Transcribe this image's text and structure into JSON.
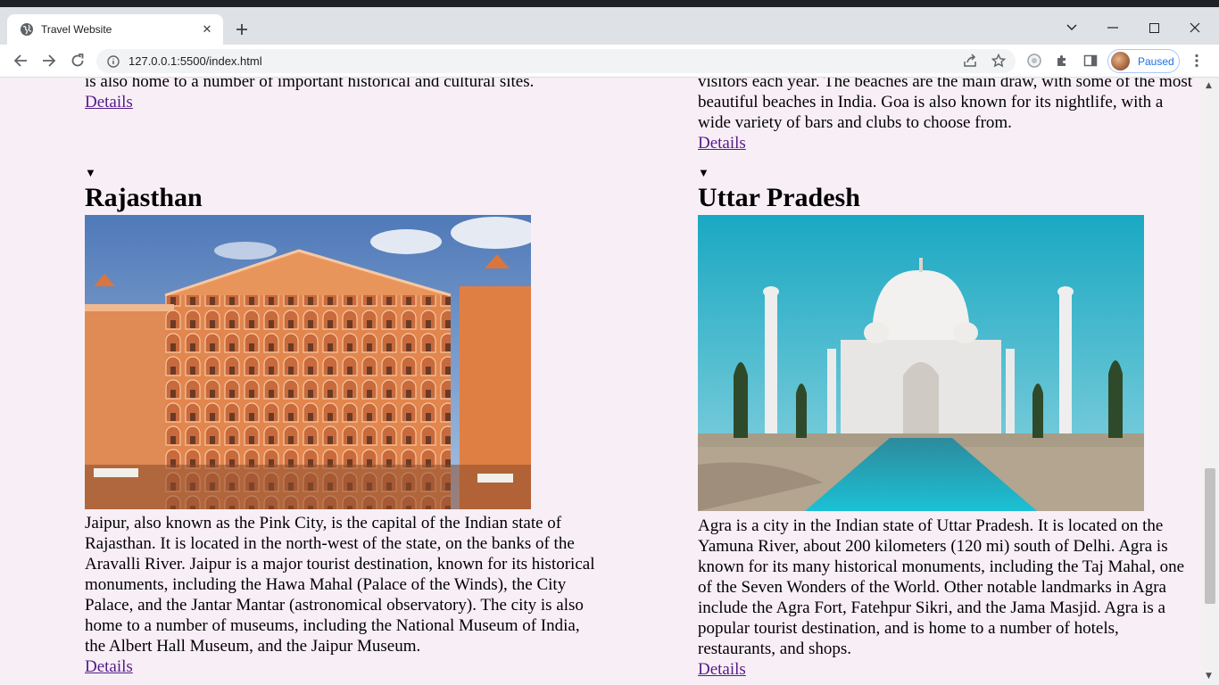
{
  "browser": {
    "tab_title": "Travel Website",
    "url": "127.0.0.1:5500/index.html",
    "profile_status": "Paused",
    "accent": "#1a73e8"
  },
  "page": {
    "left_top_partial": "is also home to a number of important historical and cultural sites.",
    "left_top_link": "Details",
    "right_top_partial": "visitors each year. The beaches are the main draw, with some of the most beautiful beaches in India. Goa is also known for its nightlife, with a wide variety of bars and clubs to choose from.",
    "right_top_link": "Details",
    "sections": [
      {
        "marker": "▼",
        "title": "Rajasthan",
        "image": "hawa-mahal-photo",
        "description": "Jaipur, also known as the Pink City, is the capital of the Indian state of Rajasthan. It is located in the north-west of the state, on the banks of the Aravalli River. Jaipur is a major tourist destination, known for its historical monuments, including the Hawa Mahal (Palace of the Winds), the City Palace, and the Jantar Mantar (astronomical observatory). The city is also home to a number of museums, including the National Museum of India, the Albert Hall Museum, and the Jaipur Museum.",
        "link": "Details"
      },
      {
        "marker": "▼",
        "title": "Uttar Pradesh",
        "image": "taj-mahal-photo",
        "description": "Agra is a city in the Indian state of Uttar Pradesh. It is located on the Yamuna River, about 200 kilometers (120 mi) south of Delhi. Agra is known for its many historical monuments, including the Taj Mahal, one of the Seven Wonders of the World. Other notable landmarks in Agra include the Agra Fort, Fatehpur Sikri, and the Jama Masjid. Agra is a popular tourist destination, and is home to a number of hotels, restaurants, and shops.",
        "link": "Details"
      }
    ]
  }
}
